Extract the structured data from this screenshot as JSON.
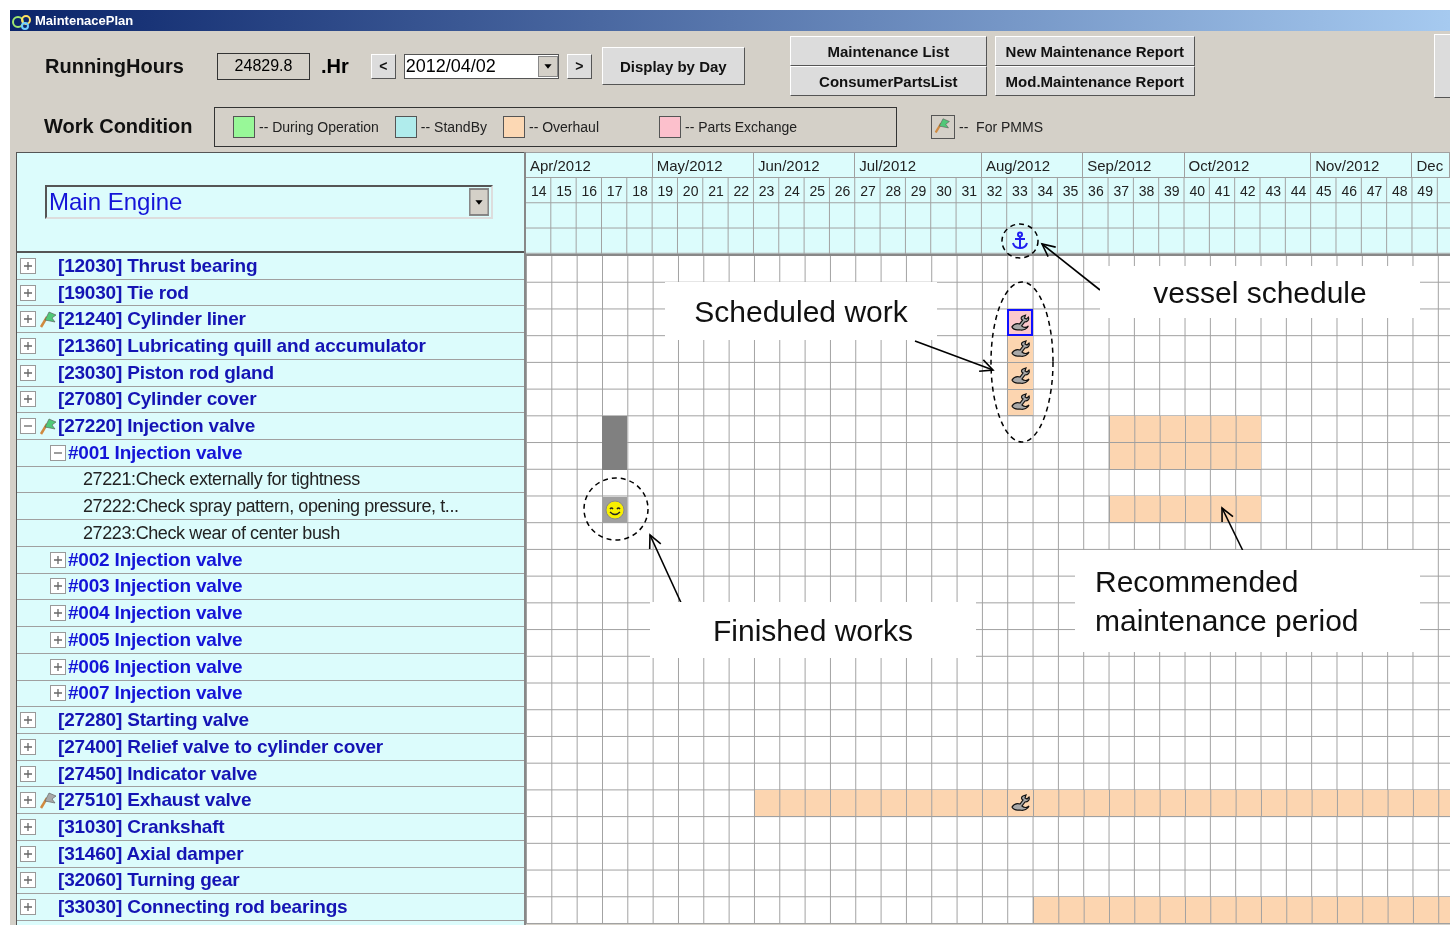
{
  "window": {
    "title": "MaintenacePlan"
  },
  "toolbar": {
    "running_hours_label": "RunningHours",
    "running_hours": "24829.8",
    "unit": ".Hr",
    "prev": "<",
    "date": "2012/04/02",
    "next": ">",
    "display_button": "Display by Day",
    "button_groups": [
      {
        "buttons": [
          "Maintenance List",
          "ConsumerPartsList"
        ]
      },
      {
        "buttons": [
          "New Maintenance Report",
          "Mod.Maintenance Report"
        ]
      }
    ]
  },
  "work_condition": {
    "label": "Work Condition",
    "legend": [
      {
        "kind": "swatch",
        "label": "-- During Operation",
        "color": "#98f898"
      },
      {
        "kind": "swatch",
        "label": "-- StandBy",
        "color": "#b0ecec"
      },
      {
        "kind": "swatch",
        "label": "-- Overhaul",
        "color": "#fcd8b4"
      },
      {
        "kind": "swatch",
        "label": "-- Parts Exchange",
        "color": "#fcc0cc"
      },
      {
        "kind": "flag",
        "label": "--  For PMMS"
      }
    ]
  },
  "equipment": {
    "value": "Main Engine"
  },
  "timeline": {
    "months": [
      {
        "label": "Apr/2012",
        "weeks": [
          {
            "label": "14",
            "kind": "plain"
          },
          {
            "label": "15",
            "kind": "plain"
          },
          {
            "label": "16",
            "kind": "plain"
          },
          {
            "label": "17",
            "kind": "plain"
          },
          {
            "label": "18",
            "kind": "plain"
          }
        ]
      },
      {
        "label": "May/2012",
        "weeks": [
          {
            "label": "19",
            "kind": "plain"
          },
          {
            "label": "20",
            "kind": "plain"
          },
          {
            "label": "21",
            "kind": "plain"
          },
          {
            "label": "22",
            "kind": "plain"
          }
        ]
      },
      {
        "label": "Jun/2012",
        "weeks": [
          {
            "label": "23",
            "kind": "plain"
          },
          {
            "label": "24",
            "kind": "plain"
          },
          {
            "label": "25",
            "kind": "plain"
          },
          {
            "label": "26",
            "kind": "plain"
          }
        ]
      },
      {
        "label": "Jul/2012",
        "weeks": [
          {
            "label": "27",
            "kind": "plain"
          },
          {
            "label": "28",
            "kind": "plain"
          },
          {
            "label": "29",
            "kind": "plain"
          },
          {
            "label": "30",
            "kind": "plain"
          },
          {
            "label": "31",
            "kind": "plain"
          }
        ]
      },
      {
        "label": "Aug/2012",
        "weeks": [
          {
            "label": "32",
            "kind": "plain"
          },
          {
            "label": "33",
            "kind": "anchor"
          },
          {
            "label": "34",
            "kind": "plain"
          },
          {
            "label": "35",
            "kind": "plain"
          }
        ]
      },
      {
        "label": "Sep/2012",
        "weeks": [
          {
            "label": "36",
            "kind": "plain"
          },
          {
            "label": "37",
            "kind": "plain"
          },
          {
            "label": "38",
            "kind": "plain"
          },
          {
            "label": "39",
            "kind": "plain"
          }
        ]
      },
      {
        "label": "Oct/2012",
        "weeks": [
          {
            "label": "40",
            "kind": "plain"
          },
          {
            "label": "41",
            "kind": "plain"
          },
          {
            "label": "42",
            "kind": "plain"
          },
          {
            "label": "43",
            "kind": "plain"
          },
          {
            "label": "44",
            "kind": "plain"
          }
        ]
      },
      {
        "label": "Nov/2012",
        "weeks": [
          {
            "label": "45",
            "kind": "plain"
          },
          {
            "label": "46",
            "kind": "plain"
          },
          {
            "label": "47",
            "kind": "plain"
          },
          {
            "label": "48",
            "kind": "plain"
          }
        ]
      },
      {
        "label": "Dec",
        "weeks": [
          {
            "label": "49",
            "kind": "plain"
          }
        ]
      }
    ]
  },
  "tree": [
    {
      "kind": "group",
      "label": "[12030] Thrust bearing",
      "expanded": false
    },
    {
      "kind": "group",
      "label": "[19030] Tie rod",
      "expanded": false
    },
    {
      "kind": "group",
      "label": "[21240] Cylinder liner",
      "expanded": false,
      "flag": {
        "color": "#50c878"
      },
      "work_selected": true,
      "cells": [
        {
          "kind": "none"
        },
        {
          "kind": "none"
        },
        {
          "kind": "none"
        },
        {
          "kind": "none"
        },
        {
          "kind": "none"
        },
        {
          "kind": "none"
        },
        {
          "kind": "none"
        },
        {
          "kind": "none"
        },
        {
          "kind": "none"
        },
        {
          "kind": "none"
        },
        {
          "kind": "none"
        },
        {
          "kind": "none"
        },
        {
          "kind": "none"
        },
        {
          "kind": "none"
        },
        {
          "kind": "none"
        },
        {
          "kind": "none"
        },
        {
          "kind": "none"
        },
        {
          "kind": "none"
        },
        {
          "kind": "none"
        },
        {
          "kind": "scheduled"
        }
      ]
    },
    {
      "kind": "group",
      "label": "[21360] Lubricating quill and accumulator",
      "expanded": false,
      "work_selected": false,
      "cells": [
        {
          "kind": "none"
        },
        {
          "kind": "none"
        },
        {
          "kind": "none"
        },
        {
          "kind": "none"
        },
        {
          "kind": "none"
        },
        {
          "kind": "none"
        },
        {
          "kind": "none"
        },
        {
          "kind": "none"
        },
        {
          "kind": "none"
        },
        {
          "kind": "none"
        },
        {
          "kind": "none"
        },
        {
          "kind": "none"
        },
        {
          "kind": "none"
        },
        {
          "kind": "none"
        },
        {
          "kind": "none"
        },
        {
          "kind": "none"
        },
        {
          "kind": "none"
        },
        {
          "kind": "none"
        },
        {
          "kind": "none"
        },
        {
          "kind": "scheduled"
        }
      ]
    },
    {
      "kind": "group",
      "label": "[23030] Piston rod gland",
      "expanded": false,
      "work_selected": false,
      "cells": [
        {
          "kind": "none"
        },
        {
          "kind": "none"
        },
        {
          "kind": "none"
        },
        {
          "kind": "none"
        },
        {
          "kind": "none"
        },
        {
          "kind": "none"
        },
        {
          "kind": "none"
        },
        {
          "kind": "none"
        },
        {
          "kind": "none"
        },
        {
          "kind": "none"
        },
        {
          "kind": "none"
        },
        {
          "kind": "none"
        },
        {
          "kind": "none"
        },
        {
          "kind": "none"
        },
        {
          "kind": "none"
        },
        {
          "kind": "none"
        },
        {
          "kind": "none"
        },
        {
          "kind": "none"
        },
        {
          "kind": "none"
        },
        {
          "kind": "scheduled"
        }
      ]
    },
    {
      "kind": "group",
      "label": "[27080] Cylinder cover",
      "expanded": false,
      "work_selected": false,
      "cells": [
        {
          "kind": "none"
        },
        {
          "kind": "none"
        },
        {
          "kind": "none"
        },
        {
          "kind": "none"
        },
        {
          "kind": "none"
        },
        {
          "kind": "none"
        },
        {
          "kind": "none"
        },
        {
          "kind": "none"
        },
        {
          "kind": "none"
        },
        {
          "kind": "none"
        },
        {
          "kind": "none"
        },
        {
          "kind": "none"
        },
        {
          "kind": "none"
        },
        {
          "kind": "none"
        },
        {
          "kind": "none"
        },
        {
          "kind": "none"
        },
        {
          "kind": "none"
        },
        {
          "kind": "none"
        },
        {
          "kind": "none"
        },
        {
          "kind": "scheduled"
        }
      ]
    },
    {
      "kind": "group",
      "label": "[27220] Injection valve",
      "expanded": true,
      "flag": {
        "color": "#50c878"
      },
      "cells": [
        {
          "kind": "none"
        },
        {
          "kind": "none"
        },
        {
          "kind": "none"
        },
        {
          "kind": "completed"
        },
        {
          "kind": "none"
        },
        {
          "kind": "none"
        },
        {
          "kind": "none"
        },
        {
          "kind": "none"
        },
        {
          "kind": "none"
        },
        {
          "kind": "none"
        },
        {
          "kind": "none"
        },
        {
          "kind": "none"
        },
        {
          "kind": "none"
        },
        {
          "kind": "none"
        },
        {
          "kind": "none"
        },
        {
          "kind": "none"
        },
        {
          "kind": "none"
        },
        {
          "kind": "none"
        },
        {
          "kind": "none"
        },
        {
          "kind": "none"
        },
        {
          "kind": "none"
        },
        {
          "kind": "none"
        },
        {
          "kind": "none"
        },
        {
          "kind": "recommended"
        },
        {
          "kind": "recommended"
        },
        {
          "kind": "recommended"
        },
        {
          "kind": "recommended"
        },
        {
          "kind": "recommended"
        },
        {
          "kind": "recommended"
        }
      ],
      "children": [
        {
          "kind": "unit",
          "label": "#001 Injection valve",
          "expanded": true,
          "cells": [
            {
              "kind": "none"
            },
            {
              "kind": "none"
            },
            {
              "kind": "none"
            },
            {
              "kind": "completed"
            },
            {
              "kind": "none"
            },
            {
              "kind": "none"
            },
            {
              "kind": "none"
            },
            {
              "kind": "none"
            },
            {
              "kind": "none"
            },
            {
              "kind": "none"
            },
            {
              "kind": "none"
            },
            {
              "kind": "none"
            },
            {
              "kind": "none"
            },
            {
              "kind": "none"
            },
            {
              "kind": "none"
            },
            {
              "kind": "none"
            },
            {
              "kind": "none"
            },
            {
              "kind": "none"
            },
            {
              "kind": "none"
            },
            {
              "kind": "none"
            },
            {
              "kind": "none"
            },
            {
              "kind": "none"
            },
            {
              "kind": "none"
            },
            {
              "kind": "recommended"
            },
            {
              "kind": "recommended"
            },
            {
              "kind": "recommended"
            },
            {
              "kind": "recommended"
            },
            {
              "kind": "recommended"
            },
            {
              "kind": "recommended"
            }
          ],
          "children": [
            {
              "kind": "task",
              "label": "27221:Check externally for tightness"
            },
            {
              "kind": "task",
              "label": "27222:Check spray pattern, opening pressure, t...",
              "cells": [
                {
                  "kind": "none"
                },
                {
                  "kind": "none"
                },
                {
                  "kind": "none"
                },
                {
                  "kind": "finished"
                },
                {
                  "kind": "none"
                },
                {
                  "kind": "none"
                },
                {
                  "kind": "none"
                },
                {
                  "kind": "none"
                },
                {
                  "kind": "none"
                },
                {
                  "kind": "none"
                },
                {
                  "kind": "none"
                },
                {
                  "kind": "none"
                },
                {
                  "kind": "none"
                },
                {
                  "kind": "none"
                },
                {
                  "kind": "none"
                },
                {
                  "kind": "none"
                },
                {
                  "kind": "none"
                },
                {
                  "kind": "none"
                },
                {
                  "kind": "none"
                },
                {
                  "kind": "none"
                },
                {
                  "kind": "none"
                },
                {
                  "kind": "none"
                },
                {
                  "kind": "none"
                },
                {
                  "kind": "recommended"
                },
                {
                  "kind": "recommended"
                },
                {
                  "kind": "recommended"
                },
                {
                  "kind": "recommended"
                },
                {
                  "kind": "recommended"
                },
                {
                  "kind": "recommended"
                }
              ]
            },
            {
              "kind": "task",
              "label": "27223:Check wear of center bush"
            }
          ]
        },
        {
          "kind": "unit",
          "label": "#002 Injection valve",
          "expanded": false
        },
        {
          "kind": "unit",
          "label": "#003 Injection valve",
          "expanded": false
        },
        {
          "kind": "unit",
          "label": "#004 Injection valve",
          "expanded": false
        },
        {
          "kind": "unit",
          "label": "#005 Injection valve",
          "expanded": false
        },
        {
          "kind": "unit",
          "label": "#006 Injection valve",
          "expanded": false
        },
        {
          "kind": "unit",
          "label": "#007 Injection valve",
          "expanded": false
        }
      ]
    },
    {
      "kind": "group",
      "label": "[27280] Starting valve",
      "expanded": false
    },
    {
      "kind": "group",
      "label": "[27400] Relief valve to cylinder cover",
      "expanded": false
    },
    {
      "kind": "group",
      "label": "[27450] Indicator valve",
      "expanded": false
    },
    {
      "kind": "group",
      "label": "[27510] Exhaust valve",
      "expanded": false,
      "flag": {
        "color": "#a8a8a8"
      },
      "work_selected": false,
      "cells": [
        {
          "kind": "none"
        },
        {
          "kind": "none"
        },
        {
          "kind": "none"
        },
        {
          "kind": "none"
        },
        {
          "kind": "none"
        },
        {
          "kind": "none"
        },
        {
          "kind": "none"
        },
        {
          "kind": "none"
        },
        {
          "kind": "none"
        },
        {
          "kind": "recommended"
        },
        {
          "kind": "recommended"
        },
        {
          "kind": "recommended"
        },
        {
          "kind": "recommended"
        },
        {
          "kind": "recommended"
        },
        {
          "kind": "recommended"
        },
        {
          "kind": "recommended"
        },
        {
          "kind": "recommended"
        },
        {
          "kind": "recommended"
        },
        {
          "kind": "recommended"
        },
        {
          "kind": "scheduled"
        },
        {
          "kind": "recommended"
        },
        {
          "kind": "recommended"
        },
        {
          "kind": "recommended"
        },
        {
          "kind": "recommended"
        },
        {
          "kind": "recommended"
        },
        {
          "kind": "recommended"
        },
        {
          "kind": "recommended"
        },
        {
          "kind": "recommended"
        },
        {
          "kind": "recommended"
        },
        {
          "kind": "recommended"
        },
        {
          "kind": "recommended"
        },
        {
          "kind": "recommended"
        },
        {
          "kind": "recommended"
        },
        {
          "kind": "recommended"
        },
        {
          "kind": "recommended"
        },
        {
          "kind": "recommended"
        }
      ]
    },
    {
      "kind": "group",
      "label": "[31030] Crankshaft",
      "expanded": false
    },
    {
      "kind": "group",
      "label": "[31460] Axial damper",
      "expanded": false
    },
    {
      "kind": "group",
      "label": "[32060] Turning gear",
      "expanded": false
    },
    {
      "kind": "group",
      "label": "[33030] Connecting rod bearings",
      "expanded": false,
      "cells": [
        {
          "kind": "none"
        },
        {
          "kind": "none"
        },
        {
          "kind": "none"
        },
        {
          "kind": "none"
        },
        {
          "kind": "none"
        },
        {
          "kind": "none"
        },
        {
          "kind": "none"
        },
        {
          "kind": "none"
        },
        {
          "kind": "none"
        },
        {
          "kind": "none"
        },
        {
          "kind": "none"
        },
        {
          "kind": "none"
        },
        {
          "kind": "none"
        },
        {
          "kind": "none"
        },
        {
          "kind": "none"
        },
        {
          "kind": "none"
        },
        {
          "kind": "none"
        },
        {
          "kind": "none"
        },
        {
          "kind": "none"
        },
        {
          "kind": "none"
        },
        {
          "kind": "recommended"
        },
        {
          "kind": "recommended"
        },
        {
          "kind": "recommended"
        },
        {
          "kind": "recommended"
        },
        {
          "kind": "recommended"
        },
        {
          "kind": "recommended"
        },
        {
          "kind": "recommended"
        },
        {
          "kind": "recommended"
        },
        {
          "kind": "recommended"
        },
        {
          "kind": "recommended"
        },
        {
          "kind": "recommended"
        },
        {
          "kind": "recommended"
        },
        {
          "kind": "recommended"
        },
        {
          "kind": "recommended"
        },
        {
          "kind": "recommended"
        },
        {
          "kind": "recommended"
        }
      ]
    }
  ],
  "annotations": [
    {
      "kind": "scheduled",
      "text": "Scheduled work"
    },
    {
      "kind": "vessel",
      "text": "vessel schedule"
    },
    {
      "kind": "finished",
      "text": "Finished works"
    },
    {
      "kind": "recommended",
      "text": "Recommended maintenance period"
    }
  ]
}
